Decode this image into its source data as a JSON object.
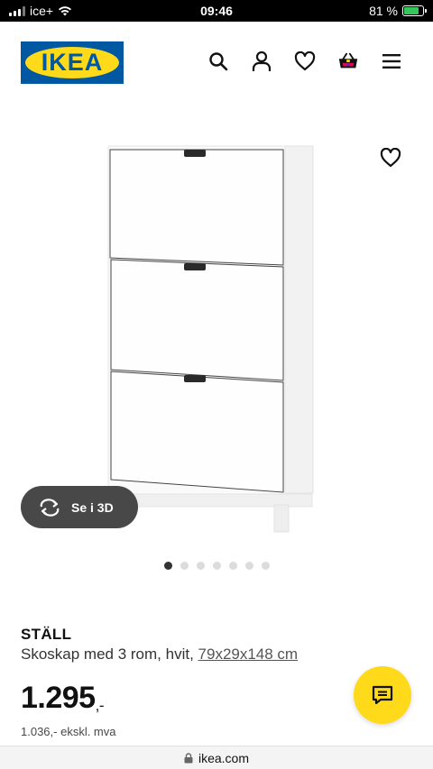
{
  "status_bar": {
    "carrier": "ice+",
    "time": "09:46",
    "battery_percent_text": "81 %",
    "battery_level": 0.81
  },
  "header": {
    "logo_text": "IKEA",
    "icons": [
      "search-icon",
      "account-icon",
      "heart-icon",
      "cart-icon",
      "menu-icon"
    ]
  },
  "gallery": {
    "see_3d_label": "Se i 3D",
    "image_count": 7,
    "active_index": 0
  },
  "product": {
    "name": "STÄLL",
    "description": "Skoskap med 3 rom, hvit, ",
    "dimensions": "79x29x148 cm",
    "price_main": "1.295",
    "price_suffix": ",-",
    "price_ex_vat": "1.036,- ekskl. mva"
  },
  "browser": {
    "url": "ikea.com"
  },
  "colors": {
    "ikea_blue": "#0058a3",
    "ikea_yellow": "#ffda1a",
    "see3d_bg": "#484848"
  }
}
